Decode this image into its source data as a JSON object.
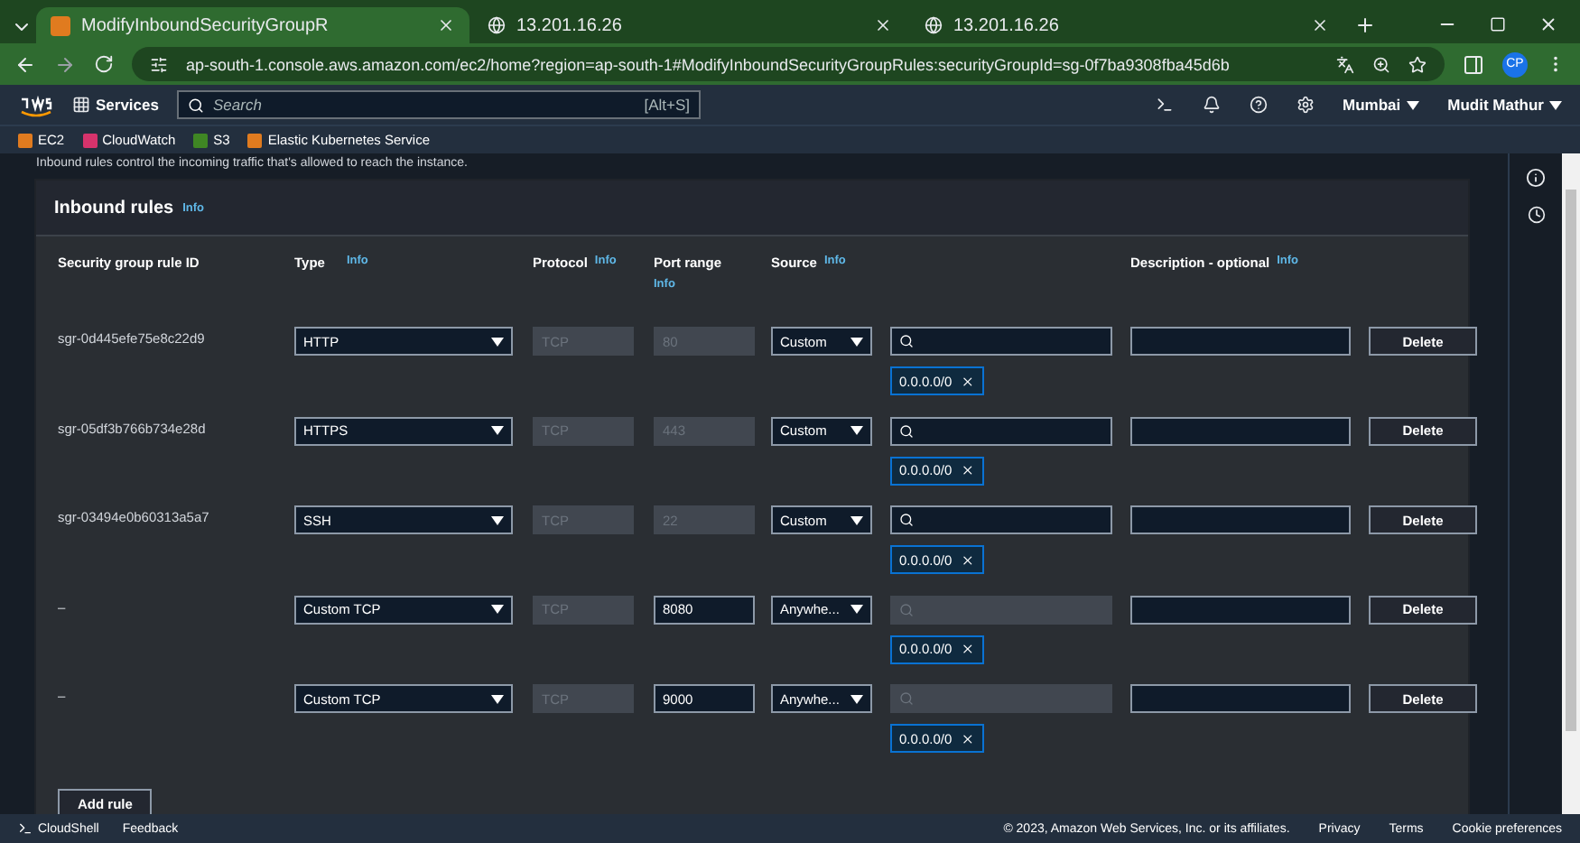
{
  "browser": {
    "tabs": [
      {
        "title": "ModifyInboundSecurityGroupR",
        "selected": true,
        "kind": "aws"
      },
      {
        "title": "13.201.16.26",
        "selected": false,
        "kind": "globe"
      },
      {
        "title": "13.201.16.26",
        "selected": false,
        "kind": "globe"
      }
    ],
    "url": "ap-south-1.console.aws.amazon.com/ec2/home?region=ap-south-1#ModifyInboundSecurityGroupRules:securityGroupId=sg-0f7ba9308fba45d6b",
    "profile": "CP"
  },
  "aws_nav": {
    "services": "Services",
    "search_placeholder": "Search",
    "search_shortcut": "[Alt+S]",
    "region": "Mumbai",
    "user": "Mudit Mathur"
  },
  "favorites": [
    {
      "label": "EC2",
      "color": "#e07b1f"
    },
    {
      "label": "CloudWatch",
      "color": "#d6336c"
    },
    {
      "label": "S3",
      "color": "#3f8624"
    },
    {
      "label": "Elastic Kubernetes Service",
      "color": "#e07b1f"
    }
  ],
  "description": "Inbound rules control the incoming traffic that's allowed to reach the instance.",
  "panel": {
    "title": "Inbound rules",
    "title_info": "Info",
    "columns": [
      {
        "label": "Security group rule ID"
      },
      {
        "label": "Type",
        "info": "Info"
      },
      {
        "label": "Protocol",
        "info": "Info"
      },
      {
        "label": "Port range",
        "info": "Info"
      },
      {
        "label": "Source",
        "info": "Info"
      },
      {
        "label": "Description - optional",
        "info": "Info"
      }
    ],
    "rows": [
      {
        "id": "sgr-0d445efe75e8c22d9",
        "type": "HTTP",
        "protocol": "TCP",
        "port": "80",
        "port_disabled": true,
        "source": "Custom",
        "search_disabled": false,
        "cidr": "0.0.0.0/0",
        "action": "Delete"
      },
      {
        "id": "sgr-05df3b766b734e28d",
        "type": "HTTPS",
        "protocol": "TCP",
        "port": "443",
        "port_disabled": true,
        "source": "Custom",
        "search_disabled": false,
        "cidr": "0.0.0.0/0",
        "action": "Delete"
      },
      {
        "id": "sgr-03494e0b60313a5a7",
        "type": "SSH",
        "protocol": "TCP",
        "port": "22",
        "port_disabled": true,
        "source": "Custom",
        "search_disabled": false,
        "cidr": "0.0.0.0/0",
        "action": "Delete"
      },
      {
        "id": "–",
        "type": "Custom TCP",
        "protocol": "TCP",
        "port": "8080",
        "port_disabled": false,
        "source": "Anywhe...",
        "search_disabled": true,
        "cidr": "0.0.0.0/0",
        "action": "Delete"
      },
      {
        "id": "–",
        "type": "Custom TCP",
        "protocol": "TCP",
        "port": "9000",
        "port_disabled": false,
        "source": "Anywhe...",
        "search_disabled": true,
        "cidr": "0.0.0.0/0",
        "action": "Delete"
      }
    ],
    "add_button": "Add rule"
  },
  "footer": {
    "left": [
      "CloudShell",
      "Feedback"
    ],
    "copyright": "© 2023, Amazon Web Services, Inc. or its affiliates.",
    "links": [
      "Privacy",
      "Terms",
      "Cookie preferences"
    ]
  }
}
